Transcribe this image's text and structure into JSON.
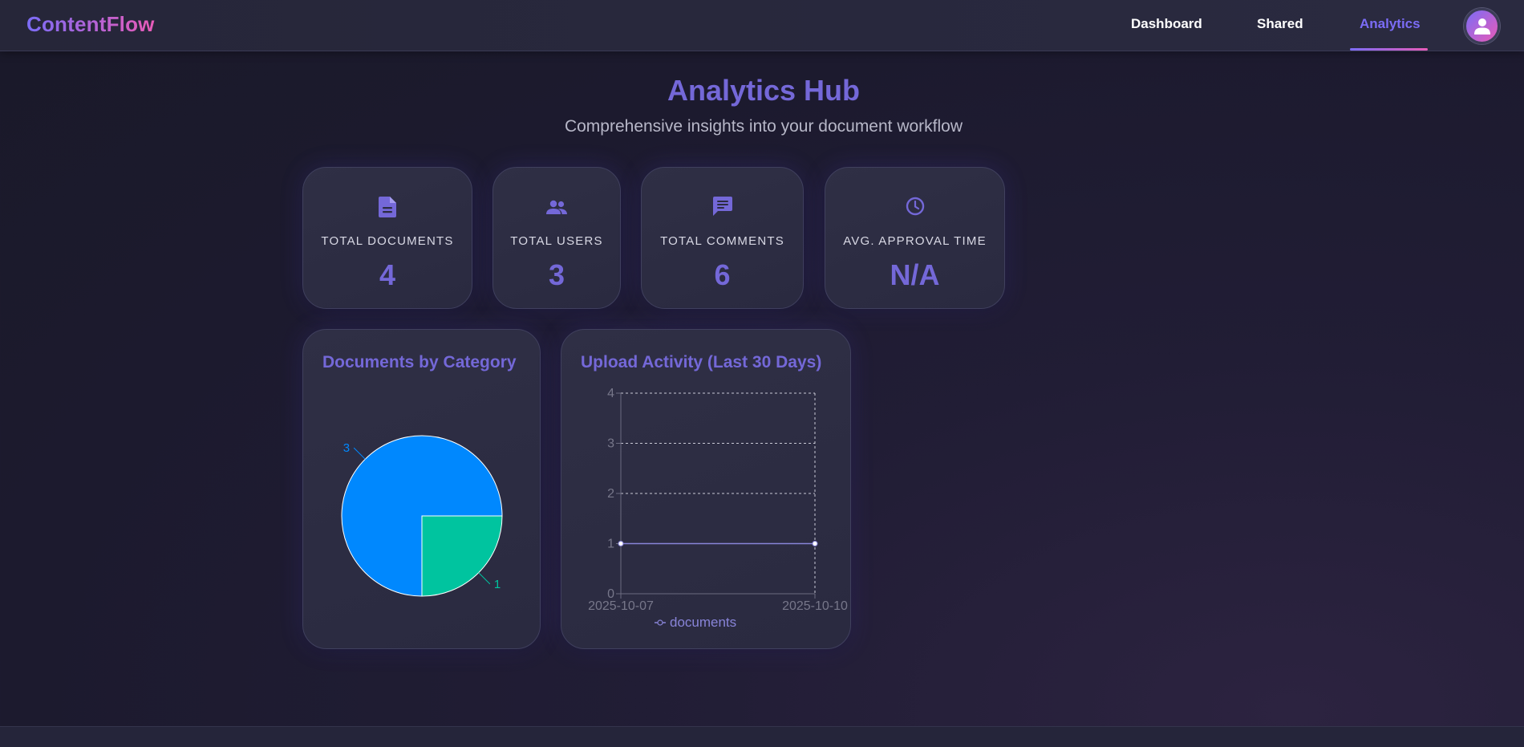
{
  "app": {
    "brand": "ContentFlow"
  },
  "nav": {
    "items": [
      {
        "label": "Dashboard",
        "active": false
      },
      {
        "label": "Shared",
        "active": false
      },
      {
        "label": "Analytics",
        "active": true
      }
    ]
  },
  "header": {
    "title": "Analytics Hub",
    "subtitle": "Comprehensive insights into your document workflow"
  },
  "stats": [
    {
      "icon": "document-icon",
      "label": "TOTAL DOCUMENTS",
      "value": "4"
    },
    {
      "icon": "users-icon",
      "label": "TOTAL USERS",
      "value": "3"
    },
    {
      "icon": "comment-icon",
      "label": "TOTAL COMMENTS",
      "value": "6"
    },
    {
      "icon": "clock-icon",
      "label": "AVG. APPROVAL TIME",
      "value": "N/A"
    }
  ],
  "colors": {
    "accent": "#7468d8",
    "brand_gradient_start": "#7b6cf6",
    "brand_gradient_end": "#e85bb8",
    "pie_blue": "#0088fe",
    "pie_green": "#00c49f",
    "line_color": "#8884d8"
  },
  "chart_data": [
    {
      "type": "pie",
      "title": "Documents by Category",
      "slices": [
        {
          "value": 3,
          "label": "3",
          "color": "#0088fe"
        },
        {
          "value": 1,
          "label": "1",
          "color": "#00c49f"
        }
      ]
    },
    {
      "type": "line",
      "title": "Upload Activity (Last 30 Days)",
      "x": [
        "2025-10-07",
        "2025-10-10"
      ],
      "series": [
        {
          "name": "documents",
          "values": [
            1,
            1
          ]
        }
      ],
      "ylim": [
        0,
        4
      ],
      "yticks": [
        0,
        1,
        2,
        3,
        4
      ],
      "grid": true,
      "legend": "bottom"
    }
  ]
}
